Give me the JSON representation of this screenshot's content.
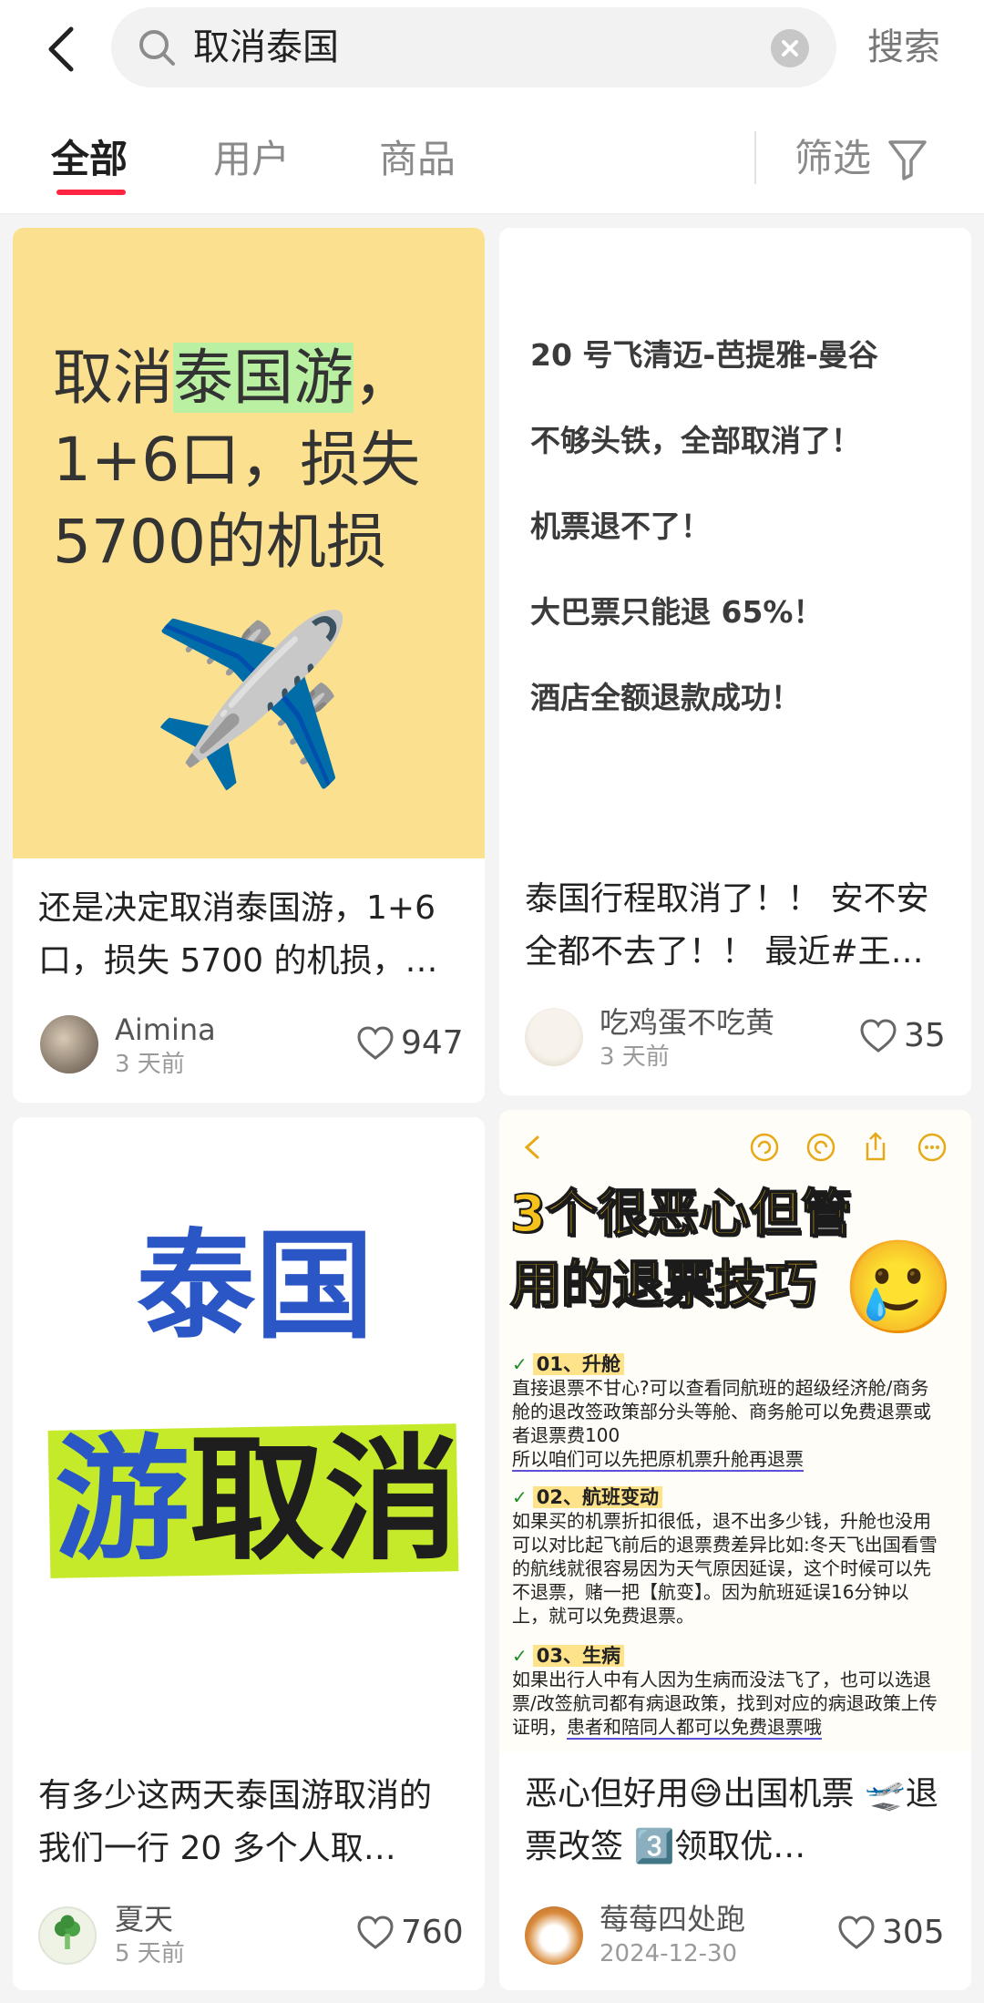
{
  "search": {
    "query": "取消泰国",
    "action_label": "搜索"
  },
  "tabs": [
    {
      "label": "全部",
      "active": true
    },
    {
      "label": "用户",
      "active": false
    },
    {
      "label": "商品",
      "active": false
    }
  ],
  "filter": {
    "label": "筛选"
  },
  "colors": {
    "accent": "#ff2442",
    "card1_bg": "#fae08f",
    "highlight_green": "#b9f0a1"
  },
  "posts": [
    {
      "cover_text": {
        "line1_a": "取消",
        "line1_hl": "泰国游",
        "line1_b": "，",
        "line2": "1+6口，损失",
        "line3": "5700的机损"
      },
      "cover_emoji": "✈️",
      "title": "还是决定取消泰国游，1+6口，损失 5700 的机损，…",
      "author": "Aimina",
      "date": "3 天前",
      "likes": "947"
    },
    {
      "cover_lines": [
        "20 号飞清迈-芭提雅-曼谷",
        "不够头铁，全部取消了！",
        "机票退不了！",
        "大巴票只能退 65%！",
        "酒店全额退款成功！"
      ],
      "title": "泰国行程取消了！！ 安不安全都不去了！！ 最近#王…",
      "author": "吃鸡蛋不吃黄",
      "date": "3 天前",
      "likes": "35"
    },
    {
      "cover_text": {
        "top": "泰国",
        "bottom_a": "游",
        "bottom_b": "取消"
      },
      "title": "有多少这两天泰国游取消的 我们一行 20 多个人取…",
      "author": "夏天",
      "date": "5 天前",
      "likes": "760"
    },
    {
      "cover_headline": [
        "3个很恶心但管",
        "用的退票技巧"
      ],
      "cover_emoji": "🥲",
      "sections": [
        {
          "title": "01、升舱",
          "body": "直接退票不甘心?可以查看同航班的超级经济舱/商务舱的退改签政策部分头等舱、商务舱可以免费退票或者退票费100",
          "tail": "所以咱们可以先把原机票升舱再退票"
        },
        {
          "title": "02、航班变动",
          "body": "如果买的机票折扣很低，退不出多少钱，升舱也没用可以对比起飞前后的退票费差异比如:冬天飞出国看雪的航线就很容易因为天气原因延误，这个时候可以先不退票，赌一把【航变】。因为航班延误16分钟以上，就可以免费退票。",
          "tail": ""
        },
        {
          "title": "03、生病",
          "body": "如果出行人中有人因为生病而没法飞了，也可以选退票/改签航司都有病退政策，找到对应的病退政策上传证明，",
          "tail": "患者和陪同人都可以免费退票哦"
        }
      ],
      "title": "恶心但好用😅出国机票 🛫退票改签 3️⃣领取优…",
      "author": "莓莓四处跑",
      "date": "2024-12-30",
      "likes": "305"
    }
  ]
}
